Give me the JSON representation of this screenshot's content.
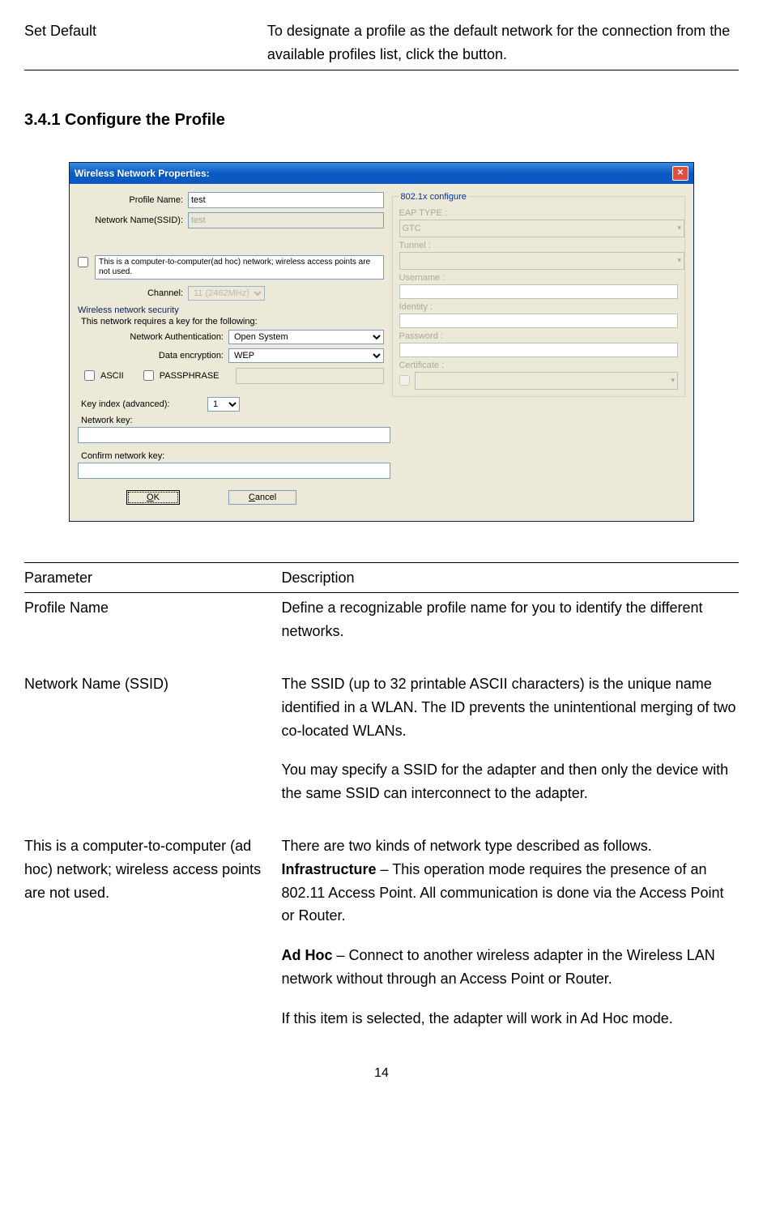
{
  "top_table": {
    "param": "Set Default",
    "desc": "To designate a profile as the default network for the connection from the available profiles list, click the button."
  },
  "section_heading": "3.4.1    Configure the Profile",
  "dialog": {
    "title": "Wireless Network Properties:",
    "profile_name_label": "Profile Name:",
    "profile_name_value": "test",
    "ssid_label": "Network Name(SSID):",
    "ssid_value": "test",
    "adhoc_text": "This is a computer-to-computer(ad hoc) network; wireless access points are not used.",
    "channel_label": "Channel:",
    "channel_value": "11 (2462MHz)",
    "security_group": "Wireless network security",
    "security_desc": "This network requires a key for the following:",
    "auth_label": "Network Authentication:",
    "auth_value": "Open System",
    "encrypt_label": "Data encryption:",
    "encrypt_value": "WEP",
    "ascii_label": "ASCII",
    "passphrase_label": "PASSPHRASE",
    "keyindex_label": "Key index (advanced):",
    "keyindex_value": "1",
    "netkey_label": "Network key:",
    "confirmkey_label": "Confirm network key:",
    "ok_btn": "OK",
    "cancel_btn": "Cancel",
    "x802_group": "802.1x configure",
    "eap_label": "EAP TYPE :",
    "eap_value": "GTC",
    "tunnel_label": "Tunnel :",
    "username_label": "Username :",
    "identity_label": "Identity :",
    "password_label": "Password :",
    "certificate_label": "Certificate :"
  },
  "param_table": {
    "header_param": "Parameter",
    "header_desc": "Description",
    "rows": [
      {
        "param": "Profile Name",
        "desc": "Define a recognizable profile name for you to identify the different networks."
      },
      {
        "param": "Network Name (SSID)",
        "desc_p1": "The SSID (up to 32 printable ASCII characters) is the unique name identified in a WLAN. The ID prevents the unintentional merging of two co-located WLANs.",
        "desc_p2": "You may specify a SSID for the adapter and then only the device with the same SSID can interconnect to the adapter."
      },
      {
        "param": "This is a computer-to-computer (ad hoc) network; wireless access points are not used.",
        "desc_p1": "There are two kinds of network type described as follows.",
        "desc_p2_bold": "Infrastructure",
        "desc_p2_rest": " – This operation mode requires the presence of an 802.11 Access Point. All communication is done via the Access Point or Router.",
        "desc_p3_bold": "Ad Hoc",
        "desc_p3_rest": " – Connect to another wireless adapter in the Wireless LAN network without through an Access Point or Router.",
        "desc_p4": "If this item is selected, the adapter will work in Ad Hoc mode."
      }
    ]
  },
  "page_number": "14"
}
